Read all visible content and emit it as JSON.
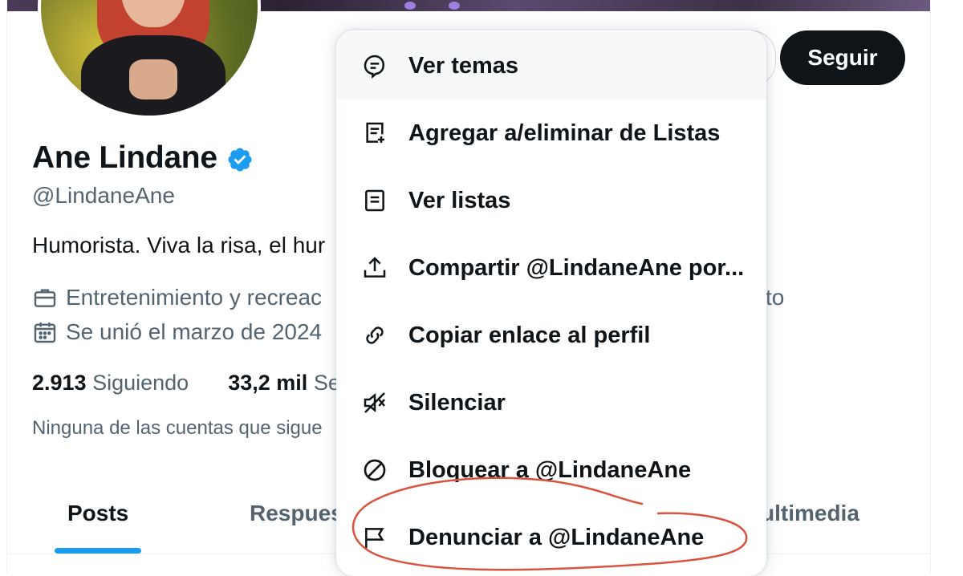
{
  "profile": {
    "display_name": "Ane Lindane",
    "handle": "@LindaneAne",
    "bio": "Humorista. Viva la risa, el hur",
    "category": "Entretenimiento y recreac",
    "category_tail": "sto",
    "joined": "Se unió el marzo de 2024",
    "following_count": "2.913",
    "following_label": "Siguiendo",
    "followers_count": "33,2 mil",
    "followers_label": "Se",
    "followers_note": "Ninguna de las cuentas que sigue",
    "follow_button": "Seguir"
  },
  "tabs": [
    {
      "label": "Posts",
      "active": true
    },
    {
      "label": "Respues",
      "active": false
    },
    {
      "label": "ultimedia",
      "active": false
    }
  ],
  "menu": {
    "items": [
      {
        "label": "Ver temas",
        "icon": "topic-icon"
      },
      {
        "label": "Agregar a/eliminar de Listas",
        "icon": "list-add-icon"
      },
      {
        "label": "Ver listas",
        "icon": "list-icon"
      },
      {
        "label": "Compartir @LindaneAne por...",
        "icon": "share-icon"
      },
      {
        "label": "Copiar enlace al perfil",
        "icon": "link-icon"
      },
      {
        "label": "Silenciar",
        "icon": "mute-icon"
      },
      {
        "label": "Bloquear a @LindaneAne",
        "icon": "block-icon"
      },
      {
        "label": "Denunciar a @LindaneAne",
        "icon": "flag-icon"
      }
    ]
  },
  "colors": {
    "accent": "#1d9bf0",
    "annotation": "#d9533f",
    "text_primary": "#0f1419",
    "text_secondary": "#536471"
  }
}
